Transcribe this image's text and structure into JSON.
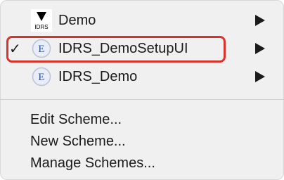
{
  "menu": {
    "schemes": [
      {
        "label": "Demo",
        "icon": "idrs-app-icon",
        "icon_text": "IDRS",
        "checked": false,
        "has_submenu": true
      },
      {
        "label": "IDRS_DemoSetupUI",
        "icon": "extension-e-icon",
        "icon_text": "E",
        "checked": true,
        "has_submenu": true
      },
      {
        "label": "IDRS_Demo",
        "icon": "extension-e-icon",
        "icon_text": "E",
        "checked": false,
        "has_submenu": true
      }
    ],
    "check_mark": "✓",
    "actions": [
      {
        "label": "Edit Scheme..."
      },
      {
        "label": "New Scheme..."
      },
      {
        "label": "Manage Schemes..."
      }
    ]
  },
  "colors": {
    "highlight": "#d8342d",
    "menu_bg": "#f0f0f0",
    "icon_circle": "#e9edf7",
    "icon_letter": "#2a4fa8"
  }
}
